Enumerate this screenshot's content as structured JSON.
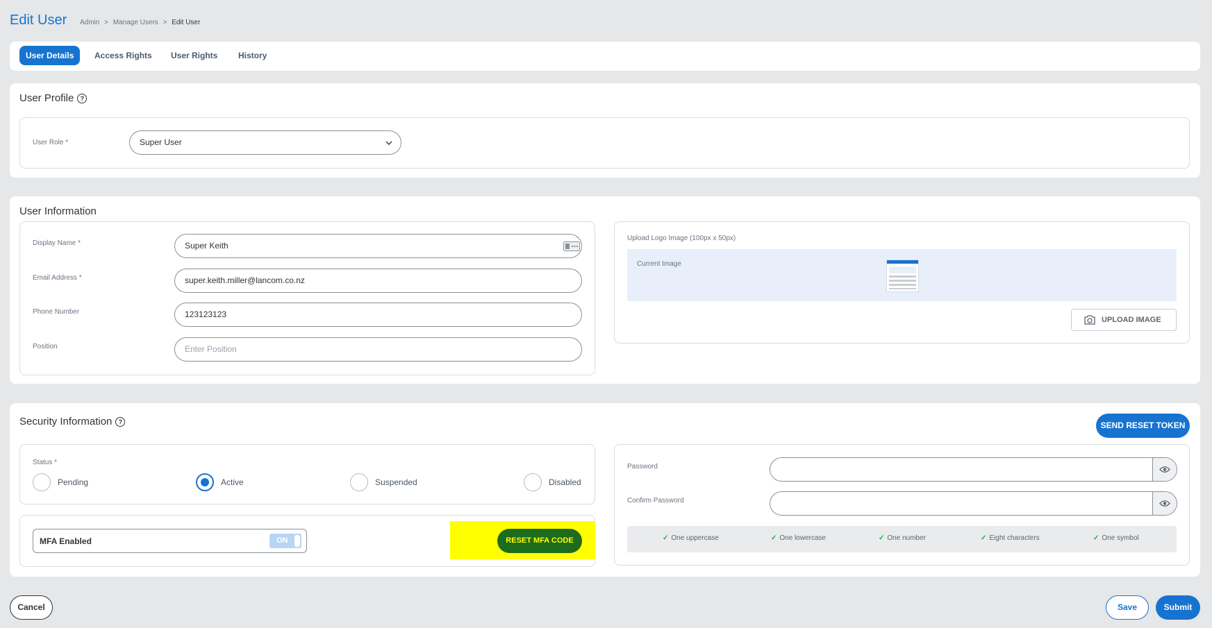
{
  "header": {
    "title": "Edit User",
    "breadcrumb": [
      "Admin",
      "Manage Users",
      "Edit User"
    ],
    "separator": ">"
  },
  "tabs": [
    {
      "label": "User Details",
      "active": true
    },
    {
      "label": "Access Rights",
      "active": false
    },
    {
      "label": "User Rights",
      "active": false
    },
    {
      "label": "History",
      "active": false
    }
  ],
  "profile": {
    "title": "User Profile",
    "help_icon": "?",
    "role_label": "User Role *",
    "role_value": "Super User"
  },
  "info": {
    "title": "User Information",
    "display_name_label": "Display Name *",
    "display_name_value": "Super Keith",
    "email_label": "Email Address *",
    "email_value": "super.keith.miller@lancom.co.nz",
    "phone_label": "Phone Number",
    "phone_value": "123123123",
    "position_label": "Position",
    "position_placeholder": "Enter Position",
    "upload_label": "Upload Logo Image (100px x 50px)",
    "current_image_label": "Current Image",
    "upload_button": "UPLOAD IMAGE"
  },
  "security": {
    "title": "Security Information",
    "help_icon": "?",
    "send_reset_token": "SEND RESET TOKEN",
    "status_label": "Status *",
    "statuses": [
      {
        "label": "Pending",
        "selected": false
      },
      {
        "label": "Active",
        "selected": true
      },
      {
        "label": "Suspended",
        "selected": false
      },
      {
        "label": "Disabled",
        "selected": false
      }
    ],
    "mfa_label": "MFA Enabled",
    "mfa_toggle": "ON",
    "reset_mfa_button": "RESET MFA CODE",
    "password_label": "Password",
    "confirm_password_label": "Confirm Password",
    "password_rules": [
      "One uppercase",
      "One lowercase",
      "One number",
      "Eight characters",
      "One symbol"
    ],
    "check_mark": "✓"
  },
  "footer": {
    "cancel": "Cancel",
    "save": "Save",
    "submit": "Submit"
  },
  "colors": {
    "accent": "#1773d0",
    "highlight": "#ffff00",
    "mfa_button": "#1d6b1d",
    "background": "#e5e7e9"
  }
}
